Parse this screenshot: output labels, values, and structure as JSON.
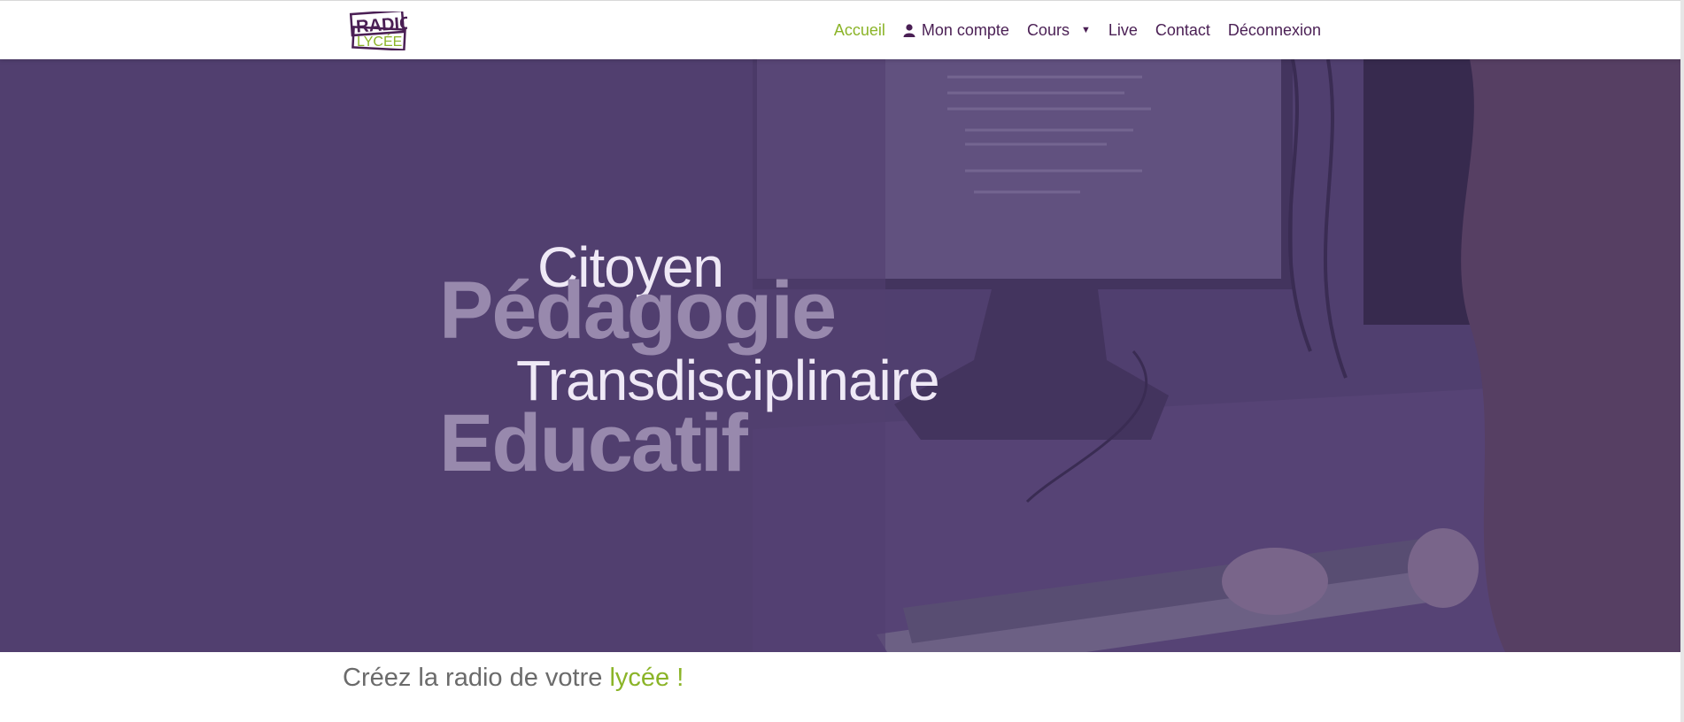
{
  "brand": {
    "logo_top": "RADIO",
    "logo_bottom": "LYCÉE",
    "logo_dark": "#4a1f54",
    "logo_green": "#8bb428"
  },
  "nav": {
    "items": [
      {
        "label": "Accueil",
        "active": true
      },
      {
        "label": "Mon compte",
        "icon": "user-icon"
      },
      {
        "label": "Cours",
        "dropdown": true,
        "icon": "caret-down-icon"
      },
      {
        "label": "Live"
      },
      {
        "label": "Contact"
      },
      {
        "label": "Déconnexion"
      }
    ],
    "active_color": "#8bb428",
    "text_color": "#4a1f54"
  },
  "hero": {
    "overlay_color": "#513f6f",
    "words": [
      "Citoyen",
      "Pédagogie",
      "Transdisciplinaire",
      "Educatif"
    ],
    "background": "student typing at computer keyboard"
  },
  "tagline": {
    "text": "Créez la radio de votre ",
    "accent": "lycée !"
  }
}
